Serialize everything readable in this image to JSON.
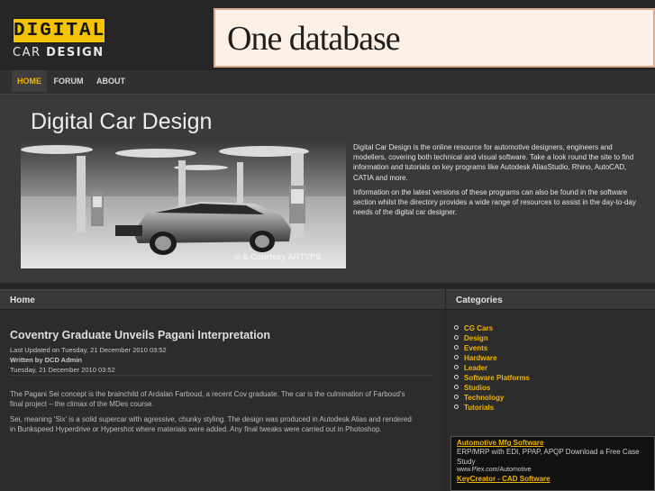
{
  "header": {
    "logo_top": "DIGITAL",
    "logo_bottom_light": "CAR",
    "logo_bottom_bold": "DESIGN",
    "banner_text": "One database"
  },
  "nav": {
    "items": [
      {
        "label": "HOME",
        "active": true
      },
      {
        "label": "FORUM",
        "active": false
      },
      {
        "label": "ABOUT",
        "active": false
      }
    ]
  },
  "hero": {
    "title": "Digital Car Design",
    "image_caption": "© & Courtesy ARTVPS",
    "paragraphs": [
      "Digital Car Design is the online resource for automotive designers, engineers and modellers, covering both technical and visual software. Take a look round the site to find information and tutorials on key programs like Autodesk AliasStudio, Rhino, AutoCAD, CATIA and more.",
      "Information on the latest versions of these programs can also be found in the software section whilst the directory provides a wide range of resources to assist in the day-to-day needs of the digital car designer."
    ]
  },
  "main": {
    "heading": "Home",
    "article": {
      "title": "Coventry Graduate Unveils Pagani Interpretation",
      "last_updated": "Last Updated on Tuesday, 21 December 2010 03:52",
      "author": "Written by DCD Admin",
      "date": "Tuesday, 21 December 2010 03:52",
      "paragraphs": [
        "The Pagani Sei concept is the brainchild of Ardalan Farboud, a recent Cov graduate. The car is the culmination of Farboud's final project – the climax of the MDes course.",
        "Sei, meaning 'Six' is a solid supercar with agressive, chunky styling. The design was produced in Autodesk Alias and rendered in Bunkspeed Hyperdrive or Hypershot where materials were added. Any final tweaks were carried out in Photoshop."
      ]
    }
  },
  "sidebar": {
    "heading": "Categories",
    "categories": [
      "CG Cars",
      "Design",
      "Events",
      "Hardware",
      "Leader",
      "Software Platforms",
      "Studios",
      "Technology",
      "Tutorials"
    ],
    "ads": [
      {
        "title": "Automotive Mfg Software",
        "desc": "ERP/MRP with EDI, PPAP, APQP Download a Free Case Study",
        "url": "www.Plex.com/Automotive"
      },
      {
        "title": "KeyCreator - CAD Software",
        "desc": "",
        "url": ""
      }
    ]
  },
  "colors": {
    "accent": "#f0b400",
    "logo_yellow": "#f4c400",
    "background": "#262626",
    "banner_bg": "#fdf0e6"
  }
}
